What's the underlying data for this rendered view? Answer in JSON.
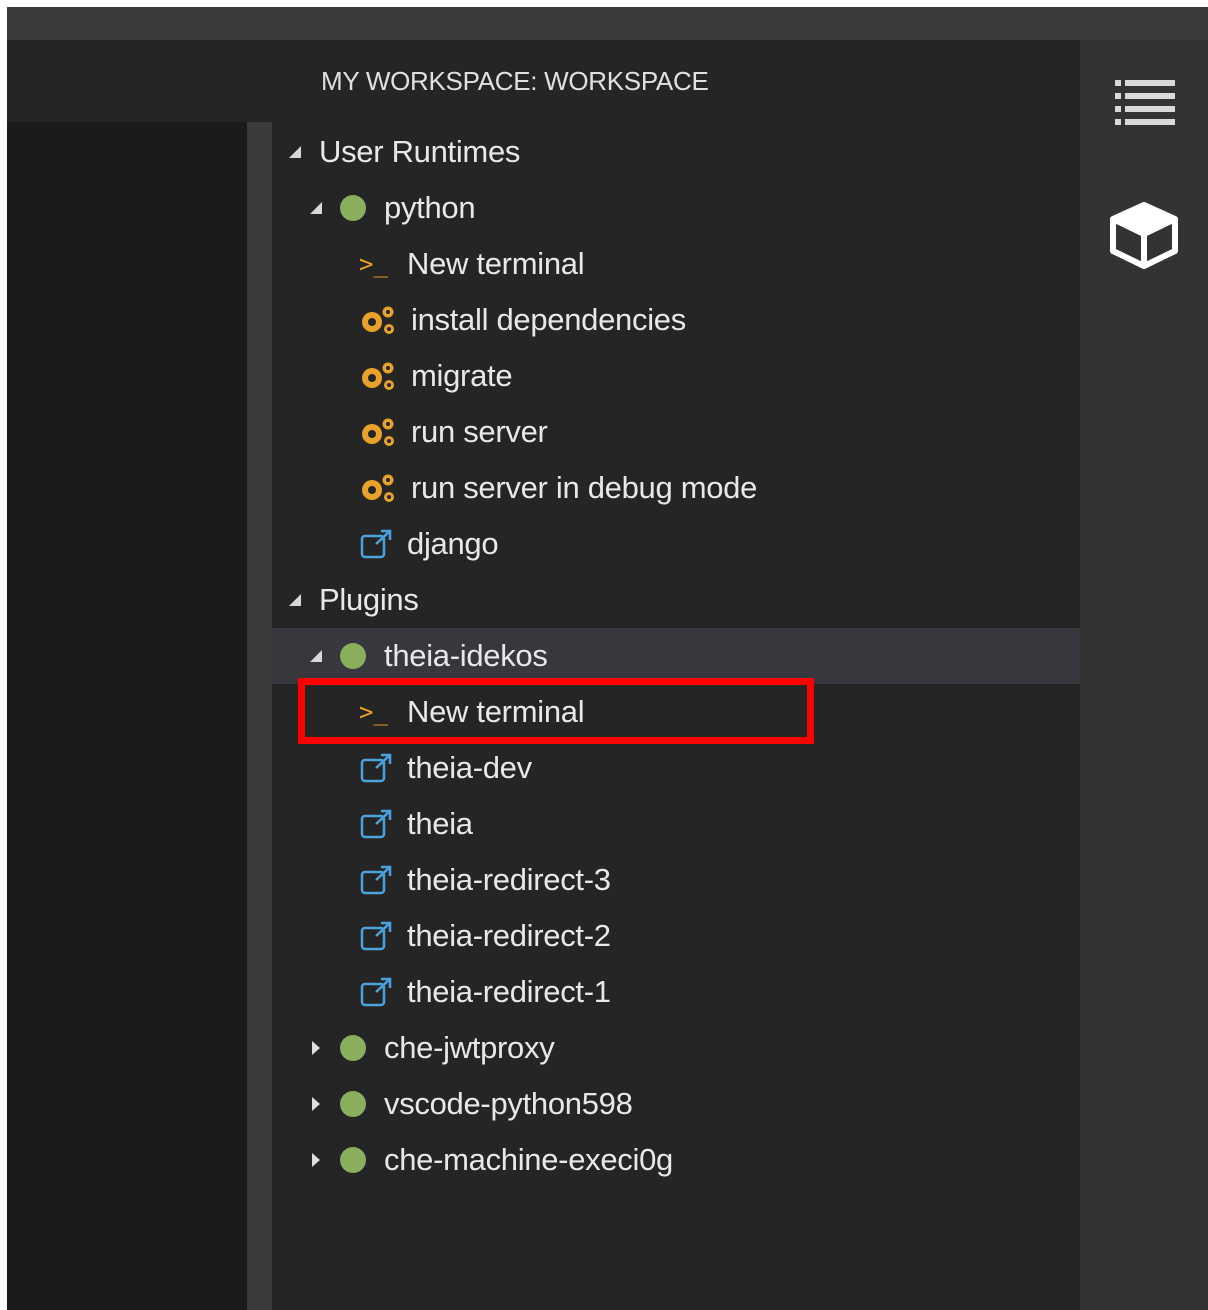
{
  "panel": {
    "title": "MY WORKSPACE: WORKSPACE"
  },
  "tree": {
    "user_runtimes": {
      "label": "User Runtimes",
      "python": {
        "label": "python",
        "items": [
          {
            "icon": "terminal-icon",
            "label": "New terminal"
          },
          {
            "icon": "gears-icon",
            "label": "install dependencies"
          },
          {
            "icon": "gears-icon",
            "label": "migrate"
          },
          {
            "icon": "gears-icon",
            "label": "run server"
          },
          {
            "icon": "gears-icon",
            "label": "run server in debug mode"
          },
          {
            "icon": "external-link-icon",
            "label": "django"
          }
        ]
      }
    },
    "plugins": {
      "label": "Plugins",
      "theia_idekos": {
        "label": "theia-idekos",
        "items": [
          {
            "icon": "terminal-icon",
            "label": "New terminal"
          },
          {
            "icon": "external-link-icon",
            "label": "theia-dev"
          },
          {
            "icon": "external-link-icon",
            "label": "theia"
          },
          {
            "icon": "external-link-icon",
            "label": "theia-redirect-3"
          },
          {
            "icon": "external-link-icon",
            "label": "theia-redirect-2"
          },
          {
            "icon": "external-link-icon",
            "label": "theia-redirect-1"
          }
        ]
      },
      "collapsed": [
        {
          "label": "che-jwtproxy"
        },
        {
          "label": "vscode-python598"
        },
        {
          "label": "che-machine-execi0g"
        }
      ]
    }
  },
  "terminal_glyph": ">_",
  "colors": {
    "status_dot": "#8bae5c",
    "terminal_accent": "#e8a12a",
    "link_accent": "#4aa3df",
    "highlight": "#ff0000"
  },
  "right_bar": {
    "icons": [
      "outline-list-icon",
      "cube-icon"
    ]
  }
}
